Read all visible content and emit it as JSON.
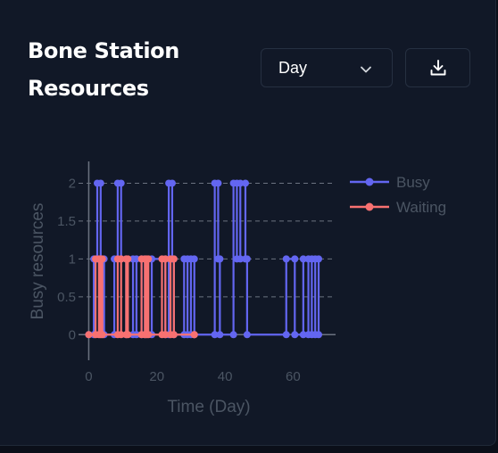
{
  "card": {
    "title": "Bone Station Resources",
    "period_select": {
      "value": "Day"
    },
    "download_icon": "download-icon",
    "chevron_icon": "chevron-down-icon"
  },
  "colors": {
    "busy": "#6366f1",
    "waiting": "#f87171",
    "axis_text": "#4b5563",
    "grid": "#6b7280"
  },
  "chart_data": {
    "type": "line",
    "xlabel": "Time (Day)",
    "ylabel": "Busy resources",
    "xlim": [
      -3,
      73
    ],
    "ylim": [
      -0.35,
      2.3
    ],
    "xticks": [
      0,
      20,
      40,
      60
    ],
    "yticks": [
      0,
      0.5,
      1,
      1.5,
      2
    ],
    "ytick_labels": [
      "0",
      "0.5",
      "1",
      "1.5",
      "2"
    ],
    "grid": "horizontal dashed",
    "legend": "right",
    "step": true,
    "series": [
      {
        "name": "Busy",
        "color": "#6366f1",
        "x": [
          0,
          1.5,
          2.5,
          3.5,
          4.5,
          7.5,
          8.5,
          9.5,
          11,
          13,
          14,
          15.5,
          16.5,
          18.5,
          22.5,
          23.5,
          24.5,
          25,
          28,
          29,
          30,
          31,
          37,
          38,
          38.5,
          42.5,
          43.5,
          44.5,
          46,
          46.5,
          58,
          60.5,
          63,
          64.5,
          65.5,
          66.5,
          67.5
        ],
        "y": [
          0,
          1,
          2,
          1,
          0,
          1,
          2,
          1,
          0,
          1,
          0,
          1,
          0,
          1,
          0,
          2,
          1,
          0,
          1,
          0,
          1,
          0,
          2,
          1,
          0,
          2,
          1,
          2,
          1,
          0,
          1,
          0,
          1,
          0,
          1,
          0,
          1
        ]
      },
      {
        "name": "Waiting",
        "color": "#f87171",
        "x": [
          0,
          2,
          3,
          3.5,
          4,
          8.5,
          9.5,
          11,
          11.5,
          15.5,
          16.5,
          17,
          17.5,
          21.5,
          22.5,
          24,
          25,
          31
        ],
        "y": [
          0,
          1,
          0,
          1,
          0,
          1,
          0,
          1,
          0,
          1,
          0,
          1,
          0,
          1,
          0,
          1,
          0,
          0
        ]
      }
    ]
  }
}
